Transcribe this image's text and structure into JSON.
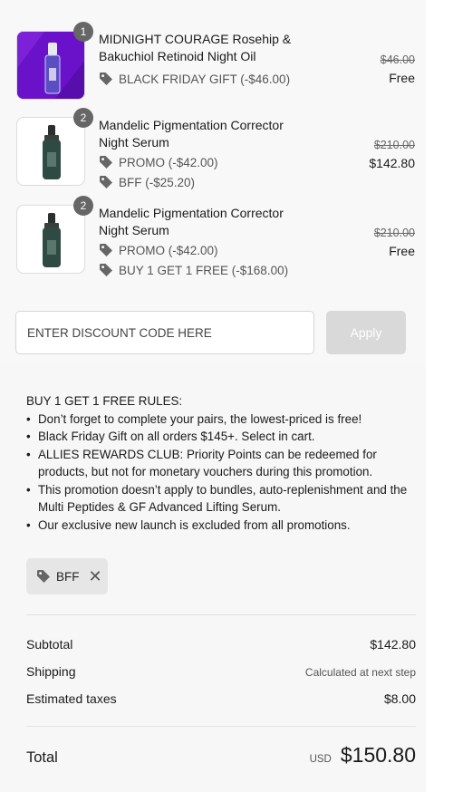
{
  "line_items": [
    {
      "quantity": "1",
      "name": "MIDNIGHT COURAGE Rosehip & Bakuchiol Retinoid Night Oil",
      "discounts": [
        "BLACK FRIDAY GIFT (-$46.00)"
      ],
      "original_price": "$46.00",
      "price": "Free",
      "thumb_color": "#6a12c9"
    },
    {
      "quantity": "2",
      "name": "Mandelic Pigmentation Corrector Night Serum",
      "discounts": [
        "PROMO (-$42.00)",
        "BFF (-$25.20)"
      ],
      "original_price": "$210.00",
      "price": "$142.80",
      "thumb_color": "#ffffff"
    },
    {
      "quantity": "2",
      "name": "Mandelic Pigmentation Corrector Night Serum",
      "discounts": [
        "PROMO (-$42.00)",
        "BUY 1 GET 1 FREE (-$168.00)"
      ],
      "original_price": "$210.00",
      "price": "Free",
      "thumb_color": "#ffffff"
    }
  ],
  "discount": {
    "placeholder": "ENTER DISCOUNT CODE HERE",
    "apply_label": "Apply"
  },
  "rules": {
    "heading": "BUY 1 GET 1 FREE RULES:",
    "items": [
      "Don’t forget to complete your pairs, the lowest-priced is free!",
      "Black Friday Gift on all orders $145+. Select in cart.",
      "ALLIES REWARDS CLUB: Priority Points can be redeemed for products, but not for monetary vouchers during this promotion.",
      "This promotion doesn’t apply to bundles, auto-replenishment and the Multi Peptides & GF Advanced Lifting Serum.",
      "Our exclusive new launch is excluded from all promotions."
    ]
  },
  "applied_code": {
    "label": "BFF",
    "remove_glyph": "✕"
  },
  "summary": {
    "subtotal_label": "Subtotal",
    "subtotal_value": "$142.80",
    "shipping_label": "Shipping",
    "shipping_value": "Calculated at next step",
    "taxes_label": "Estimated taxes",
    "taxes_value": "$8.00"
  },
  "total": {
    "label": "Total",
    "currency": "USD",
    "amount": "$150.80"
  },
  "icons": {
    "tag": "tag-icon",
    "remove": "close-icon",
    "bottle": "serum-bottle-icon"
  }
}
